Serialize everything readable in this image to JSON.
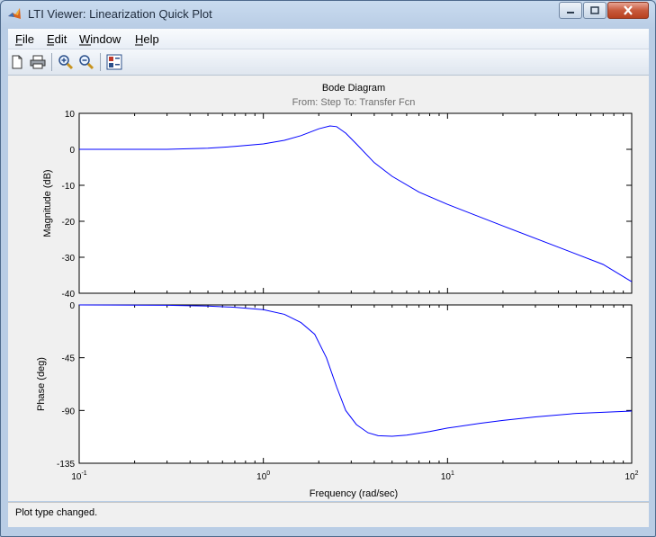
{
  "window": {
    "title": "LTI Viewer: Linearization Quick Plot",
    "controls": [
      "minimize",
      "maximize",
      "close"
    ]
  },
  "menu": [
    {
      "label": "File",
      "mnemonic": "F"
    },
    {
      "label": "Edit",
      "mnemonic": "E"
    },
    {
      "label": "Window",
      "mnemonic": "W"
    },
    {
      "label": "Help",
      "mnemonic": "H"
    }
  ],
  "toolbar": [
    "new-figure-icon",
    "print-icon",
    "zoom-in-icon",
    "zoom-out-icon",
    "plot-config-icon"
  ],
  "plot": {
    "title": "Bode Diagram",
    "subtitle": "From: Step  To: Transfer Fcn",
    "xlabel": "Frequency  (rad/sec)",
    "x_tick_labels": [
      {
        "base": "10",
        "exp": "-1"
      },
      {
        "base": "10",
        "exp": "0"
      },
      {
        "base": "10",
        "exp": "1"
      },
      {
        "base": "10",
        "exp": "2"
      }
    ]
  },
  "chart_data": [
    {
      "type": "line",
      "ylabel": "Magnitude (dB)",
      "xscale": "log",
      "xlim": [
        0.1,
        100
      ],
      "ylim": [
        -40,
        10
      ],
      "y_ticks": [
        "10",
        "0",
        "-10",
        "-20",
        "-30",
        "-40"
      ],
      "grid": false,
      "color": "#0000ff",
      "series": [
        {
          "x": [
            0.1,
            0.3,
            0.5,
            0.7,
            1.0,
            1.3,
            1.6,
            2.0,
            2.3,
            2.5,
            2.8,
            3.2,
            4.0,
            5.0,
            7.0,
            10,
            20,
            40,
            70,
            100
          ],
          "y": [
            0,
            0,
            0.3,
            0.8,
            1.5,
            2.5,
            3.8,
            5.7,
            6.5,
            6.3,
            4.5,
            1.5,
            -3.7,
            -7.5,
            -11.9,
            -15.3,
            -21.3,
            -27.2,
            -32.0,
            -36.8
          ]
        }
      ]
    },
    {
      "type": "line",
      "ylabel": "Phase (deg)",
      "xscale": "log",
      "xlim": [
        0.1,
        100
      ],
      "ylim": [
        -135,
        0
      ],
      "y_ticks": [
        "0",
        "-45",
        "-90",
        "-135"
      ],
      "grid": false,
      "color": "#0000ff",
      "series": [
        {
          "x": [
            0.1,
            0.3,
            0.5,
            0.7,
            1.0,
            1.3,
            1.6,
            1.9,
            2.2,
            2.5,
            2.8,
            3.2,
            3.7,
            4.2,
            5.0,
            6.0,
            8.0,
            10,
            15,
            20,
            30,
            50,
            100
          ],
          "y": [
            0,
            -0.3,
            -1,
            -2,
            -4,
            -8,
            -15,
            -25,
            -45,
            -70,
            -90,
            -102,
            -109,
            -111.5,
            -112,
            -111,
            -108,
            -105,
            -101,
            -98.5,
            -95.5,
            -92.5,
            -90.5
          ]
        }
      ]
    }
  ],
  "status": {
    "text": "Plot type changed."
  }
}
